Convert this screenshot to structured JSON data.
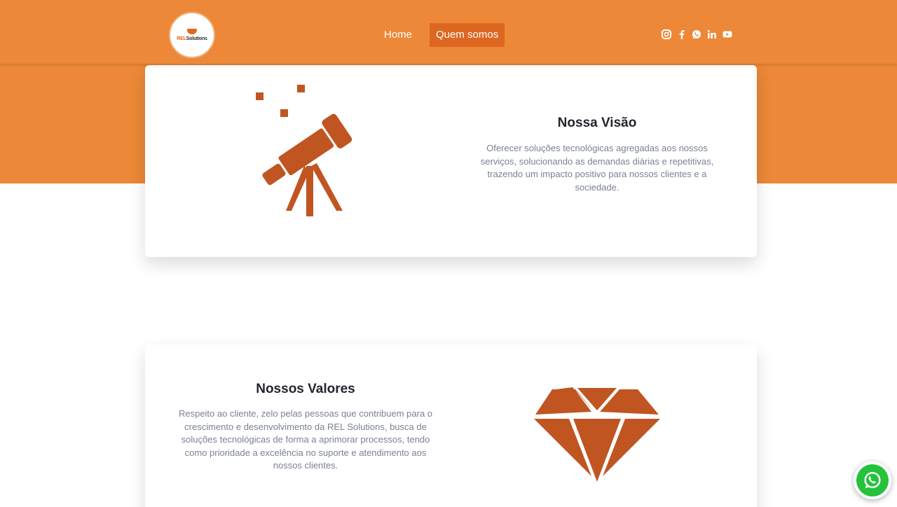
{
  "header": {
    "logo": {
      "brand": "REL",
      "name": "Solutions"
    },
    "nav": [
      {
        "label": "Home",
        "active": false
      },
      {
        "label": "Quem somos",
        "active": true
      }
    ],
    "social_icons": [
      "instagram-icon",
      "facebook-icon",
      "whatsapp-icon",
      "linkedin-icon",
      "youtube-icon"
    ]
  },
  "vision": {
    "title": "Nossa Visão",
    "text": "Oferecer soluções tecnológicas agregadas aos nossos serviços, solucionando as demandas diárias e repetitivas, trazendo um impacto positivo para nossos clientes e a sociedade.",
    "icon": "telescope-icon"
  },
  "values": {
    "title": "Nossos Valores",
    "text": "Respeito ao cliente, zelo pelas pessoas que contribuem para o crescimento e desenvolvimento da REL Solutions, busca de soluções tecnológicas de forma a aprimorar processos, tendo como prioridade a excelência no suporte e atendimento aos nossos clientes.",
    "icon": "diamond-icon"
  },
  "floating_button": {
    "icon": "whatsapp-icon"
  },
  "colors": {
    "header_bg": "#ec8837",
    "active_nav_bg": "#dd6720",
    "icon_fill": "#c05522",
    "title": "#22252e",
    "body_text": "#7a8196",
    "whatsapp_green": "#25c33b"
  }
}
